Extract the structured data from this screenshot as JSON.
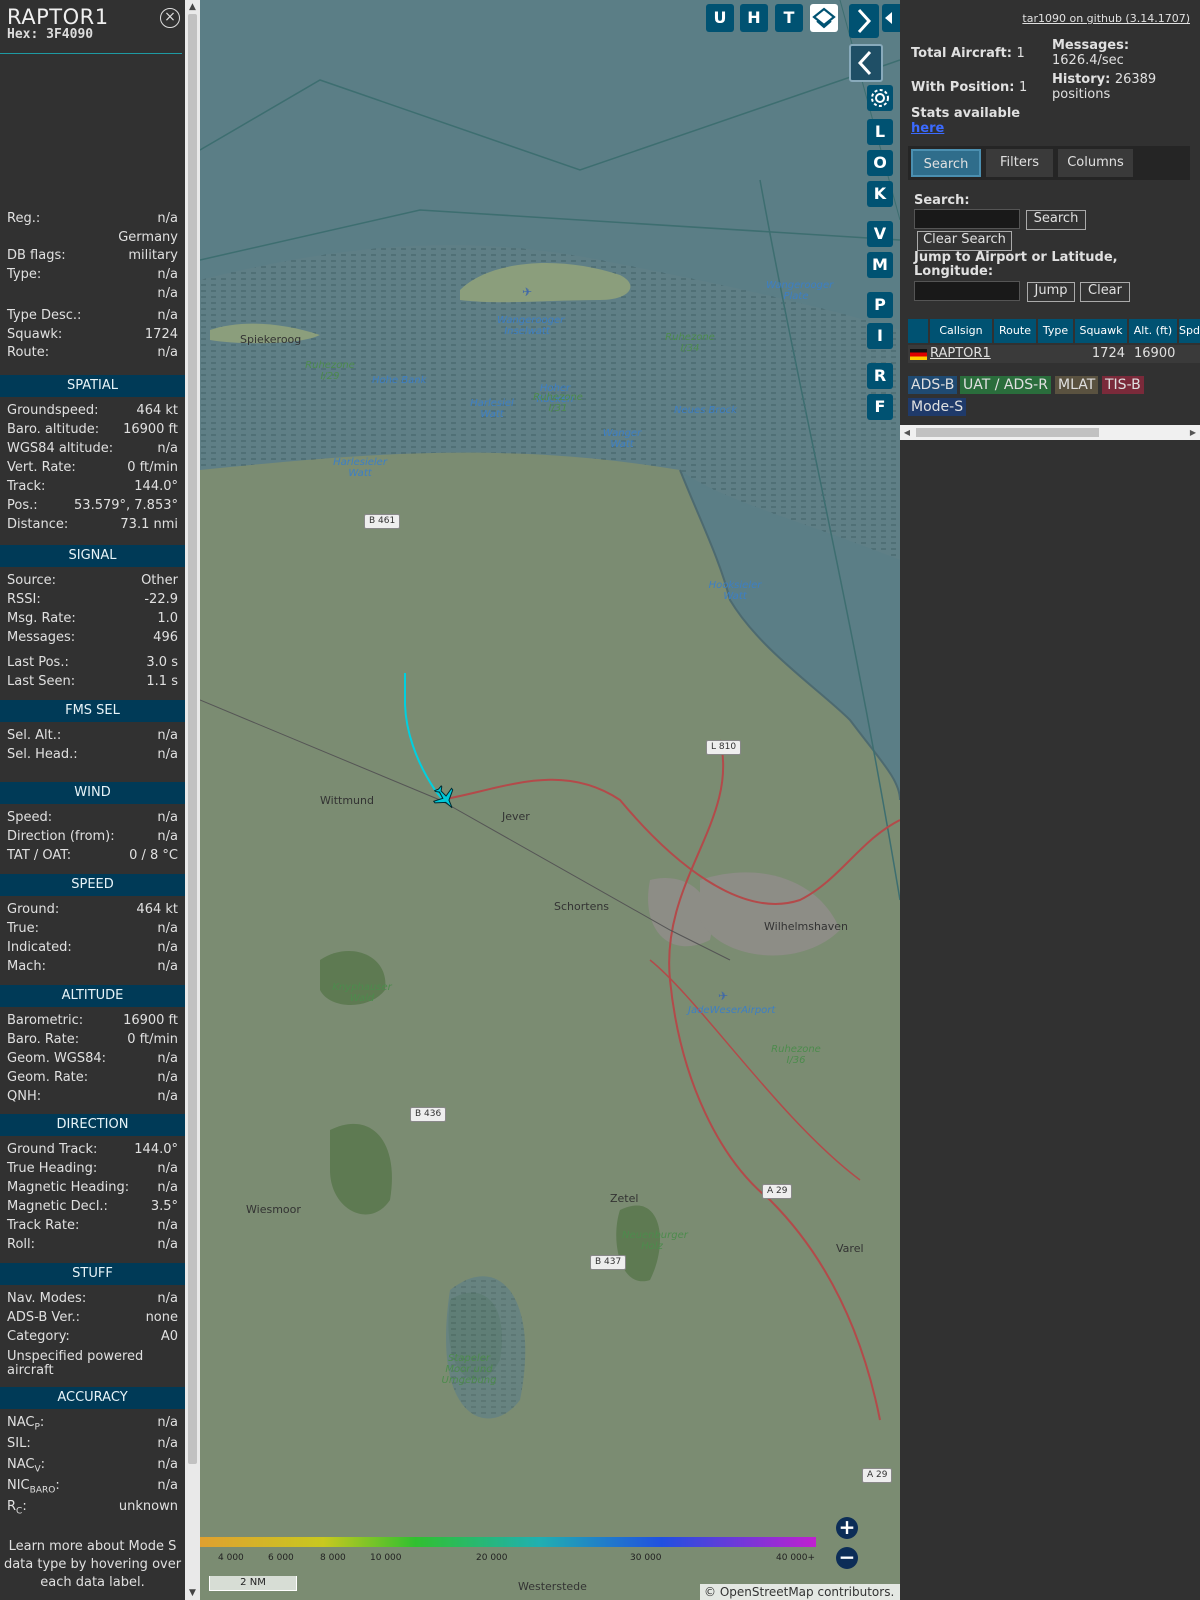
{
  "sidebar": {
    "callsign": "RAPTOR1",
    "hex": "Hex: 3F4090",
    "info": [
      {
        "k": "Reg.:",
        "v": "n/a"
      },
      {
        "k": "",
        "v": "Germany"
      },
      {
        "k": "DB flags:",
        "v": "military"
      },
      {
        "k": "Type:",
        "v": "n/a"
      },
      {
        "k": "",
        "v": "n/a"
      },
      {
        "k": "Type Desc.:",
        "v": "n/a"
      },
      {
        "k": "Squawk:",
        "v": "1724"
      },
      {
        "k": "Route:",
        "v": "n/a"
      }
    ],
    "sections": [
      {
        "title": "SPATIAL",
        "rows": [
          {
            "k": "Groundspeed:",
            "v": "464 kt"
          },
          {
            "k": "Baro. altitude:",
            "v": "16900 ft"
          },
          {
            "k": "WGS84 altitude:",
            "v": "n/a"
          },
          {
            "k": "Vert. Rate:",
            "v": "0 ft/min"
          },
          {
            "k": "Track:",
            "v": "144.0°"
          },
          {
            "k": "Pos.:",
            "v": "53.579°, 7.853°"
          },
          {
            "k": "Distance:",
            "v": "73.1 nmi"
          }
        ]
      },
      {
        "title": "SIGNAL",
        "rows": [
          {
            "k": "Source:",
            "v": "Other"
          },
          {
            "k": "RSSI:",
            "v": "-22.9"
          },
          {
            "k": "Msg. Rate:",
            "v": "1.0"
          },
          {
            "k": "Messages:",
            "v": "496"
          },
          {
            "k": "Last Pos.:",
            "v": "3.0 s"
          },
          {
            "k": "Last Seen:",
            "v": "1.1 s"
          }
        ]
      },
      {
        "title": "FMS SEL",
        "rows": [
          {
            "k": "Sel. Alt.:",
            "v": "n/a"
          },
          {
            "k": "Sel. Head.:",
            "v": "n/a"
          }
        ]
      },
      {
        "title": "WIND",
        "rows": [
          {
            "k": "Speed:",
            "v": "n/a"
          },
          {
            "k": "Direction (from):",
            "v": "n/a"
          },
          {
            "k": "TAT / OAT:",
            "v": "0 / 8 °C"
          }
        ]
      },
      {
        "title": "SPEED",
        "rows": [
          {
            "k": "Ground:",
            "v": "464 kt"
          },
          {
            "k": "True:",
            "v": "n/a"
          },
          {
            "k": "Indicated:",
            "v": "n/a"
          },
          {
            "k": "Mach:",
            "v": "n/a"
          }
        ]
      },
      {
        "title": "ALTITUDE",
        "rows": [
          {
            "k": "Barometric:",
            "v": "16900 ft"
          },
          {
            "k": "Baro. Rate:",
            "v": "0 ft/min"
          },
          {
            "k": "Geom. WGS84:",
            "v": "n/a"
          },
          {
            "k": "Geom. Rate:",
            "v": "n/a"
          },
          {
            "k": "QNH:",
            "v": "n/a"
          }
        ]
      },
      {
        "title": "DIRECTION",
        "rows": [
          {
            "k": "Ground Track:",
            "v": "144.0°"
          },
          {
            "k": "True Heading:",
            "v": "n/a"
          },
          {
            "k": "Magnetic Heading:",
            "v": "n/a"
          },
          {
            "k": "Magnetic Decl.:",
            "v": "3.5°"
          },
          {
            "k": "Track Rate:",
            "v": "n/a"
          },
          {
            "k": "Roll:",
            "v": "n/a"
          }
        ]
      },
      {
        "title": "STUFF",
        "rows": [
          {
            "k": "Nav. Modes:",
            "v": "n/a"
          },
          {
            "k": "ADS-B Ver.:",
            "v": "none"
          },
          {
            "k": "Category:",
            "v": "A0"
          }
        ],
        "extra": "Unspecified powered aircraft"
      },
      {
        "title": "ACCURACY",
        "rows": [
          {
            "k": "NACP:",
            "v": "n/a",
            "kb": "NAC",
            "ks": "P"
          },
          {
            "k": "SIL:",
            "v": "n/a"
          },
          {
            "k": "NACV:",
            "v": "n/a",
            "kb": "NAC",
            "ks": "V"
          },
          {
            "k": "NICBARO:",
            "v": "n/a",
            "kb": "NIC",
            "ks": "BARO"
          },
          {
            "k": "RC:",
            "v": "unknown",
            "kb": "R",
            "ks": "C"
          }
        ]
      }
    ],
    "footer": "Learn more about Mode S data type by hovering over each data label."
  },
  "map": {
    "top_buttons": [
      "U",
      "H",
      "T"
    ],
    "side_buttons": [
      "L",
      "O",
      "K",
      "V",
      "M",
      "P",
      "I",
      "R",
      "F"
    ],
    "scale_label": "2 NM",
    "altitude_ticks": [
      "4 000",
      "6 000",
      "8 000",
      "10 000",
      "20 000",
      "30 000",
      "40 000+"
    ],
    "attribution": "© OpenStreetMap contributors.",
    "places": [
      "Spiekeroog",
      "Wangerooger Inselwatt",
      "Hoher Rücken",
      "Harlesiel Watt",
      "Wanger Watt",
      "Neues Brock",
      "Ruhezone I/29",
      "Ruhezone I/31",
      "Ruhezone I/34",
      "Hohe Bank",
      "Harlesieler Watt",
      "Wangerooger Plate",
      "Hooksieler Watt",
      "Wittmund",
      "Jever",
      "Schortens",
      "Wilhelmshaven",
      "JadeWeserAirport",
      "Knyphauser Wald",
      "Ruhezone I/36",
      "Wiesmoor",
      "Zetel",
      "Neuenburger Holz",
      "Varel",
      "Stapeler Moor und Umgebung",
      "Westerstede"
    ],
    "roads": [
      "B 461",
      "L 810",
      "B 436",
      "B 437",
      "A 29",
      "A 29"
    ]
  },
  "panel": {
    "github": "tar1090 on github (3.14.1707)",
    "total_aircraft_label": "Total Aircraft:",
    "total_aircraft": "1",
    "with_position_label": "With Position:",
    "with_position": "1",
    "messages_label": "Messages:",
    "messages": "1626.4/sec",
    "history_label": "History:",
    "history": "26389 positions",
    "stats_label": "Stats available",
    "stats_link": "here",
    "tabs": [
      "Search",
      "Filters",
      "Columns"
    ],
    "search_label": "Search:",
    "search_button": "Search",
    "clear_search_button": "Clear Search",
    "jump_label": "Jump to Airport or Latitude, Longitude:",
    "jump_button": "Jump",
    "clear_button": "Clear",
    "table_headers": [
      "Callsign",
      "Route",
      "Type",
      "Squawk",
      "Alt. (ft)",
      "Spd"
    ],
    "table_row": {
      "callsign": "RAPTOR1",
      "route": "",
      "type": "",
      "squawk": "1724",
      "alt": "16900"
    },
    "legend": [
      {
        "label": "ADS-B",
        "color": "#1f4a72"
      },
      {
        "label": "UAT / ADS-R",
        "color": "#2a6d3c"
      },
      {
        "label": "MLAT",
        "color": "#5a5240"
      },
      {
        "label": "TIS-B",
        "color": "#7a2a3a"
      },
      {
        "label": "Mode-S",
        "color": "#1f3a6a"
      }
    ]
  }
}
